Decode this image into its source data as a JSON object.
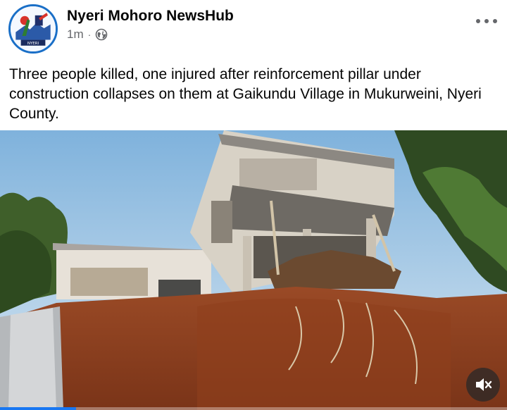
{
  "post": {
    "author": "Nyeri Mohoro NewsHub",
    "timestamp": "1m",
    "separator": "·",
    "audience_icon": "globe-icon",
    "menu_icon": "more-horizontal-icon",
    "text": "Three people killed, one injured after reinforcement pillar under construction collapses on them at Gaikundu Village in Mukurweini, Nyeri County."
  },
  "avatar": {
    "logo_text": "NYERI",
    "ring_color": "#1a6fc7"
  },
  "video": {
    "mute_icon": "speaker-muted-icon",
    "progress": 0.15,
    "progress_color": "#1877f2"
  }
}
